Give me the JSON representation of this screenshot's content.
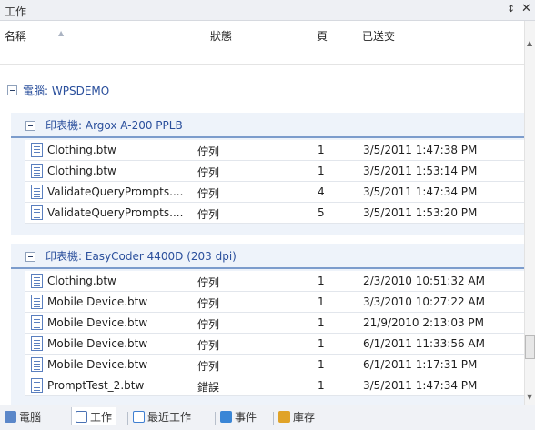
{
  "panel": {
    "title": "工作",
    "pin_icon": "pin-icon",
    "close_icon": "close-icon"
  },
  "columns": {
    "name": "名稱",
    "status": "狀態",
    "pages": "頁",
    "submitted": "已送交"
  },
  "machine_group": {
    "label": "電腦: WPSDEMO"
  },
  "printers": [
    {
      "label": "印表機: Argox A-200 PPLB",
      "jobs": [
        {
          "name": "Clothing.btw",
          "status": "佇列",
          "pages": "1",
          "submitted": "3/5/2011 1:47:38 PM"
        },
        {
          "name": "Clothing.btw",
          "status": "佇列",
          "pages": "1",
          "submitted": "3/5/2011 1:53:14 PM"
        },
        {
          "name": "ValidateQueryPrompts....",
          "status": "佇列",
          "pages": "4",
          "submitted": "3/5/2011 1:47:34 PM"
        },
        {
          "name": "ValidateQueryPrompts....",
          "status": "佇列",
          "pages": "5",
          "submitted": "3/5/2011 1:53:20 PM"
        }
      ]
    },
    {
      "label": "印表機: EasyCoder 4400D (203 dpi)",
      "jobs": [
        {
          "name": "Clothing.btw",
          "status": "佇列",
          "pages": "1",
          "submitted": "2/3/2010 10:51:32 AM"
        },
        {
          "name": "Mobile Device.btw",
          "status": "佇列",
          "pages": "1",
          "submitted": "3/3/2010 10:27:22 AM"
        },
        {
          "name": "Mobile Device.btw",
          "status": "佇列",
          "pages": "1",
          "submitted": "21/9/2010 2:13:03 PM"
        },
        {
          "name": "Mobile Device.btw",
          "status": "佇列",
          "pages": "1",
          "submitted": "6/1/2011 11:33:56 AM"
        },
        {
          "name": "Mobile Device.btw",
          "status": "佇列",
          "pages": "1",
          "submitted": "6/1/2011 1:17:31 PM"
        },
        {
          "name": "PromptTest_2.btw",
          "status": "錯誤",
          "pages": "1",
          "submitted": "3/5/2011 1:47:34 PM"
        }
      ]
    }
  ],
  "tabs": [
    {
      "label": "電腦",
      "icon": "computers-icon",
      "color": "#5b87c9"
    },
    {
      "label": "工作",
      "icon": "jobs-icon",
      "color": "#4a72b4",
      "active": true
    },
    {
      "label": "最近工作",
      "icon": "recent-jobs-icon",
      "color": "#3f7fd1"
    },
    {
      "label": "事件",
      "icon": "events-icon",
      "color": "#3a86d6"
    },
    {
      "label": "庫存",
      "icon": "inventory-icon",
      "color": "#e0a328"
    }
  ]
}
